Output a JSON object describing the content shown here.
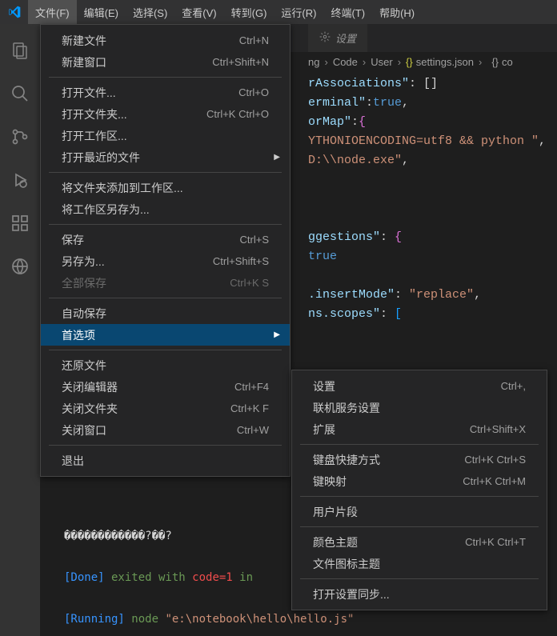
{
  "menubar": [
    {
      "label": "文件(F)",
      "active": true
    },
    {
      "label": "编辑(E)"
    },
    {
      "label": "选择(S)"
    },
    {
      "label": "查看(V)"
    },
    {
      "label": "转到(G)"
    },
    {
      "label": "运行(R)"
    },
    {
      "label": "终端(T)"
    },
    {
      "label": "帮助(H)"
    }
  ],
  "file_menu": [
    [
      {
        "label": "新建文件",
        "shortcut": "Ctrl+N"
      },
      {
        "label": "新建窗口",
        "shortcut": "Ctrl+Shift+N"
      }
    ],
    [
      {
        "label": "打开文件...",
        "shortcut": "Ctrl+O"
      },
      {
        "label": "打开文件夹...",
        "shortcut": "Ctrl+K Ctrl+O"
      },
      {
        "label": "打开工作区..."
      },
      {
        "label": "打开最近的文件",
        "submenu": true
      }
    ],
    [
      {
        "label": "将文件夹添加到工作区..."
      },
      {
        "label": "将工作区另存为..."
      }
    ],
    [
      {
        "label": "保存",
        "shortcut": "Ctrl+S"
      },
      {
        "label": "另存为...",
        "shortcut": "Ctrl+Shift+S"
      },
      {
        "label": "全部保存",
        "shortcut": "Ctrl+K S",
        "disabled": true
      }
    ],
    [
      {
        "label": "自动保存"
      },
      {
        "label": "首选项",
        "submenu": true,
        "highlighted": true
      }
    ],
    [
      {
        "label": "还原文件"
      },
      {
        "label": "关闭编辑器",
        "shortcut": "Ctrl+F4"
      },
      {
        "label": "关闭文件夹",
        "shortcut": "Ctrl+K F"
      },
      {
        "label": "关闭窗口",
        "shortcut": "Ctrl+W"
      }
    ],
    [
      {
        "label": "退出"
      }
    ]
  ],
  "preferences_submenu": [
    [
      {
        "label": "设置",
        "shortcut": "Ctrl+,"
      },
      {
        "label": "联机服务设置"
      },
      {
        "label": "扩展",
        "shortcut": "Ctrl+Shift+X"
      }
    ],
    [
      {
        "label": "键盘快捷方式",
        "shortcut": "Ctrl+K Ctrl+S"
      },
      {
        "label": "键映射",
        "shortcut": "Ctrl+K Ctrl+M"
      }
    ],
    [
      {
        "label": "用户片段"
      }
    ],
    [
      {
        "label": "颜色主题",
        "shortcut": "Ctrl+K Ctrl+T"
      },
      {
        "label": "文件图标主题"
      }
    ],
    [
      {
        "label": "打开设置同步..."
      }
    ]
  ],
  "tab": {
    "label": "设置"
  },
  "breadcrumb": {
    "seg1": "ng",
    "seg2": "Code",
    "seg3": "User",
    "seg4": "settings.json",
    "seg5": "co"
  },
  "code": {
    "l1a": "rAssociations\"",
    "l1b": ": []",
    "l2a": "erminal\"",
    "l2b": ":",
    "l2c": "true",
    "l2d": ",",
    "l3a": "orMap\"",
    "l3b": ":",
    "l3c": "{",
    "l4a": "YTHONIOENCODING=utf8 && python \"",
    "l4b": ",",
    "l5a": "D:\\\\node.exe\"",
    "l5b": ",",
    "l6a": "ggestions\"",
    "l6b": ": ",
    "l6c": "{",
    "l7a": "true",
    "l8a": ".insertMode\"",
    "l8b": ": ",
    "l8c": "\"replace\"",
    "l8d": ",",
    "l9a": "ns.scopes\"",
    "l9b": ": ",
    "l9c": "["
  },
  "terminal": {
    "garble": "������������?��?",
    "l2a": "[Done]",
    "l2b": " exited with ",
    "l2c": "code=1",
    "l2d": " in ",
    "l3a": "[Running]",
    "l3b": " node ",
    "l3c": "\"e:\\notebook\\hello\\hello.js\""
  }
}
